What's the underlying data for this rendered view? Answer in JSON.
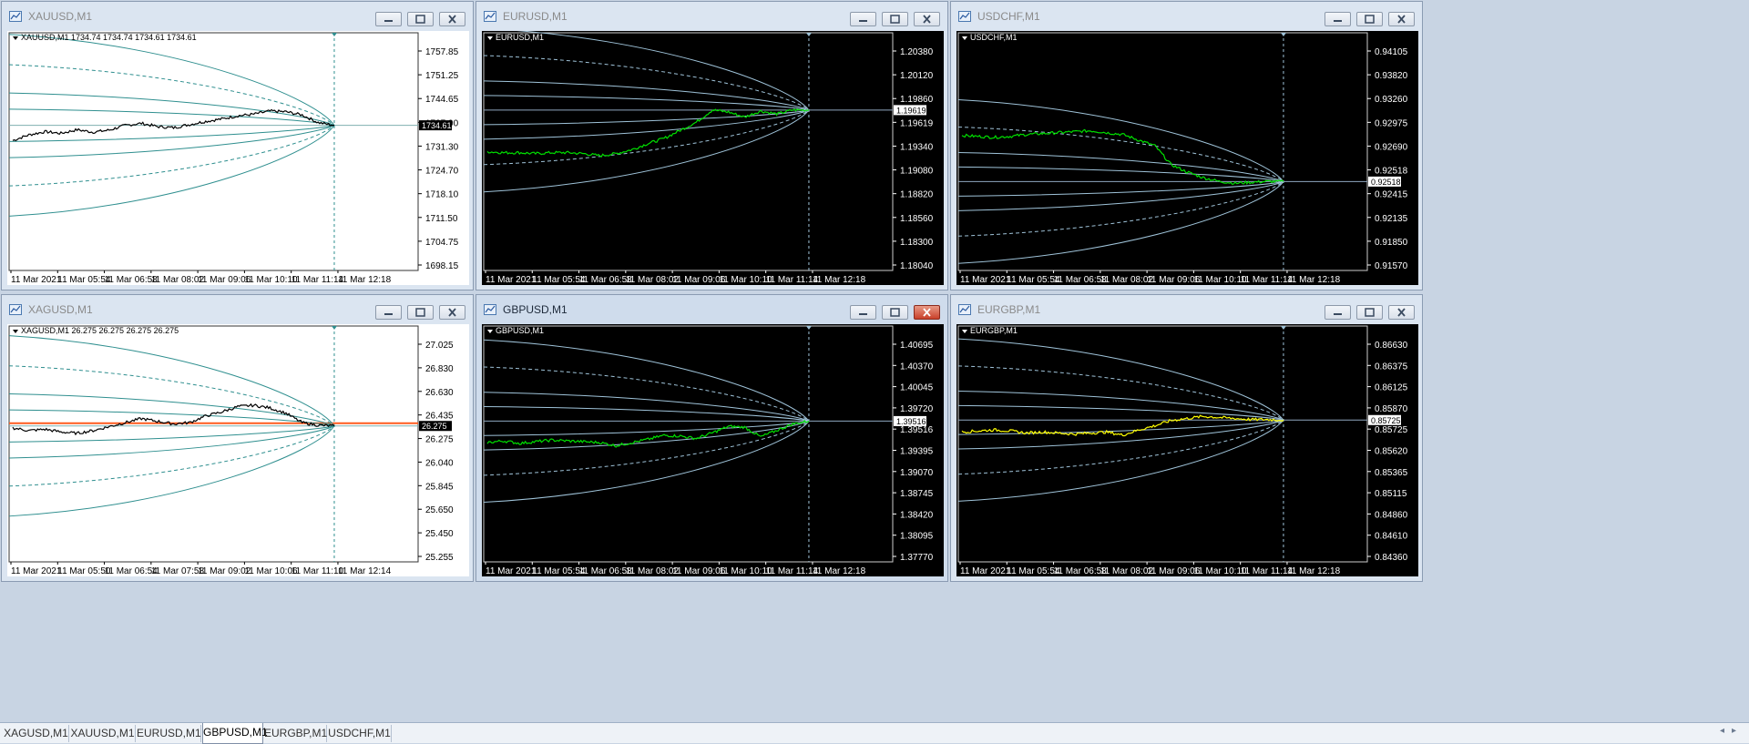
{
  "windows": [
    {
      "id": "xauusd",
      "title": "XAUUSD,M1",
      "theme": "light",
      "active": false,
      "close_red": false,
      "label": "XAUUSD,M1  1734.74 1734.74 1734.61 1734.61",
      "price_ticks": [
        "1757.85",
        "1751.25",
        "1744.65",
        "1737.90",
        "1731.30",
        "1724.70",
        "1718.10",
        "1711.50",
        "1704.75",
        "1698.15"
      ],
      "current_price": "1734.61",
      "price_marker_color": "#000000",
      "time_ticks": [
        "11 Mar 2021",
        "11 Mar 05:54",
        "11 Mar 06:58",
        "11 Mar 08:02",
        "11 Mar 09:06",
        "11 Mar 10:10",
        "11 Mar 11:14",
        "11 Mar 12:18"
      ],
      "series_color": "#000000",
      "band_color": "#2f8f8f",
      "chart_data": {
        "type": "line",
        "ylim": [
          1698.15,
          1757.85
        ],
        "x": [
          0,
          0.05,
          0.1,
          0.15,
          0.2,
          0.25,
          0.3,
          0.35,
          0.4,
          0.45,
          0.5,
          0.55,
          0.6,
          0.65,
          0.7,
          0.75,
          0.8,
          0.85,
          0.9,
          0.95,
          1.0
        ],
        "values": [
          1730.8,
          1732.2,
          1733.0,
          1732.6,
          1733.5,
          1732.9,
          1733.4,
          1734.6,
          1735.1,
          1734.3,
          1734.0,
          1734.8,
          1735.6,
          1736.2,
          1737.0,
          1737.4,
          1738.2,
          1738.0,
          1737.2,
          1735.3,
          1734.61
        ]
      }
    },
    {
      "id": "eurusd",
      "title": "EURUSD,M1",
      "theme": "dark",
      "active": false,
      "close_red": false,
      "label": "EURUSD,M1",
      "price_ticks": [
        "1.20380",
        "1.20120",
        "1.19860",
        "1.19619",
        "1.19340",
        "1.19080",
        "1.18820",
        "1.18560",
        "1.18300",
        "1.18040"
      ],
      "current_price": "1.19619",
      "price_marker_color": "#ffffff",
      "time_ticks": [
        "11 Mar 2021",
        "11 Mar 05:54",
        "11 Mar 06:58",
        "11 Mar 08:02",
        "11 Mar 09:06",
        "11 Mar 10:10",
        "11 Mar 11:14",
        "11 Mar 12:18"
      ],
      "series_color": "#00e000",
      "band_color": "#9fc3d9",
      "chart_data": {
        "type": "line",
        "ylim": [
          1.1804,
          1.2038
        ],
        "x": [
          0,
          0.05,
          0.1,
          0.15,
          0.2,
          0.25,
          0.3,
          0.35,
          0.4,
          0.45,
          0.5,
          0.55,
          0.6,
          0.65,
          0.7,
          0.75,
          0.8,
          0.85,
          0.9,
          0.95,
          1.0
        ],
        "values": [
          1.1921,
          1.192,
          1.192,
          1.1919,
          1.192,
          1.192,
          1.1919,
          1.1917,
          1.1919,
          1.1923,
          1.1929,
          1.1934,
          1.1942,
          1.195,
          1.1962,
          1.196,
          1.1955,
          1.1961,
          1.1958,
          1.1962,
          1.19619
        ]
      }
    },
    {
      "id": "usdchf",
      "title": "USDCHF,M1",
      "theme": "dark",
      "active": false,
      "close_red": false,
      "label": "USDCHF,M1",
      "price_ticks": [
        "0.94105",
        "0.93820",
        "0.93260",
        "0.92975",
        "0.92690",
        "0.92518",
        "0.92415",
        "0.92135",
        "0.91850",
        "0.91570"
      ],
      "current_price": "0.92518",
      "price_marker_color": "#ffffff",
      "time_ticks": [
        "11 Mar 2021",
        "11 Mar 05:54",
        "11 Mar 06:58",
        "11 Mar 08:02",
        "11 Mar 09:06",
        "11 Mar 10:10",
        "11 Mar 11:14",
        "11 Mar 12:18"
      ],
      "series_color": "#00e000",
      "band_color": "#9fc3d9",
      "chart_data": {
        "type": "line",
        "ylim": [
          0.9157,
          0.94105
        ],
        "x": [
          0,
          0.05,
          0.1,
          0.15,
          0.2,
          0.25,
          0.3,
          0.35,
          0.4,
          0.45,
          0.5,
          0.55,
          0.6,
          0.65,
          0.7,
          0.75,
          0.8,
          0.85,
          0.9,
          0.95,
          1.0
        ],
        "values": [
          0.9301,
          0.93,
          0.9299,
          0.93,
          0.9302,
          0.9303,
          0.9304,
          0.9305,
          0.9306,
          0.9304,
          0.9302,
          0.9296,
          0.929,
          0.927,
          0.9262,
          0.9256,
          0.9252,
          0.925,
          0.9251,
          0.9252,
          0.92518
        ]
      }
    },
    {
      "id": "xagusd",
      "title": "XAGUSD,M1",
      "theme": "light",
      "active": false,
      "close_red": false,
      "label": "XAGUSD,M1  26.275 26.275 26.275 26.275",
      "price_ticks": [
        "27.025",
        "26.830",
        "26.630",
        "26.435",
        "26.275",
        "26.040",
        "25.845",
        "25.650",
        "25.450",
        "25.255"
      ],
      "current_price": "26.275",
      "price_marker_color": "#000000",
      "time_ticks": [
        "11 Mar 2021",
        "11 Mar 05:50",
        "11 Mar 06:54",
        "11 Mar 07:58",
        "11 Mar 09:02",
        "11 Mar 10:06",
        "11 Mar 11:10",
        "11 Mar 12:14"
      ],
      "series_color": "#000000",
      "band_color": "#2f8f8f",
      "chart_data": {
        "type": "line",
        "ylim": [
          25.255,
          27.025
        ],
        "x": [
          0,
          0.05,
          0.1,
          0.15,
          0.2,
          0.25,
          0.3,
          0.35,
          0.4,
          0.45,
          0.5,
          0.55,
          0.6,
          0.65,
          0.7,
          0.75,
          0.8,
          0.85,
          0.9,
          0.95,
          1.0
        ],
        "values": [
          26.26,
          26.24,
          26.25,
          26.23,
          26.22,
          26.24,
          26.27,
          26.3,
          26.33,
          26.31,
          26.29,
          26.3,
          26.35,
          26.38,
          26.42,
          26.43,
          26.41,
          26.37,
          26.3,
          26.28,
          26.275
        ]
      }
    },
    {
      "id": "gbpusd",
      "title": "GBPUSD,M1",
      "theme": "dark",
      "active": true,
      "close_red": true,
      "label": "GBPUSD,M1",
      "price_ticks": [
        "1.40695",
        "1.40370",
        "1.40045",
        "1.39720",
        "1.39516",
        "1.39395",
        "1.39070",
        "1.38745",
        "1.38420",
        "1.38095",
        "1.37770"
      ],
      "current_price": "1.39516",
      "price_marker_color": "#ffffff",
      "time_ticks": [
        "11 Mar 2021",
        "11 Mar 05:54",
        "11 Mar 06:58",
        "11 Mar 08:02",
        "11 Mar 09:06",
        "11 Mar 10:10",
        "11 Mar 11:14",
        "11 Mar 12:18"
      ],
      "series_color": "#00e000",
      "band_color": "#9fc3d9",
      "chart_data": {
        "type": "line",
        "ylim": [
          1.3777,
          1.40695
        ],
        "x": [
          0,
          0.05,
          0.1,
          0.15,
          0.2,
          0.25,
          0.3,
          0.35,
          0.4,
          0.45,
          0.5,
          0.55,
          0.6,
          0.65,
          0.7,
          0.75,
          0.8,
          0.85,
          0.9,
          0.95,
          1.0
        ],
        "values": [
          1.3925,
          1.3927,
          1.3924,
          1.3926,
          1.3928,
          1.3927,
          1.3926,
          1.3925,
          1.3921,
          1.3925,
          1.3929,
          1.3934,
          1.3933,
          1.393,
          1.3937,
          1.3945,
          1.3944,
          1.3932,
          1.394,
          1.3948,
          1.39516
        ]
      }
    },
    {
      "id": "eurgbp",
      "title": "EURGBP,M1",
      "theme": "dark",
      "active": false,
      "close_red": false,
      "label": "EURGBP,M1",
      "price_ticks": [
        "0.86630",
        "0.86375",
        "0.86125",
        "0.85870",
        "0.85725",
        "0.85620",
        "0.85365",
        "0.85115",
        "0.84860",
        "0.84610",
        "0.84360"
      ],
      "current_price": "0.85725",
      "price_marker_color": "#ffffff",
      "time_ticks": [
        "11 Mar 2021",
        "11 Mar 05:54",
        "11 Mar 06:58",
        "11 Mar 08:02",
        "11 Mar 09:06",
        "11 Mar 10:10",
        "11 Mar 11:14",
        "11 Mar 12:18"
      ],
      "series_color": "#ffff00",
      "band_color": "#9fc3d9",
      "chart_data": {
        "type": "line",
        "ylim": [
          0.8436,
          0.8663
        ],
        "x": [
          0,
          0.05,
          0.1,
          0.15,
          0.2,
          0.25,
          0.3,
          0.35,
          0.4,
          0.45,
          0.5,
          0.55,
          0.6,
          0.65,
          0.7,
          0.75,
          0.8,
          0.85,
          0.9,
          0.95,
          1.0
        ],
        "values": [
          0.8561,
          0.8562,
          0.8563,
          0.8562,
          0.856,
          0.8561,
          0.856,
          0.8559,
          0.856,
          0.8561,
          0.8558,
          0.8563,
          0.8567,
          0.8572,
          0.8574,
          0.8576,
          0.8575,
          0.8574,
          0.8573,
          0.8573,
          0.85725
        ]
      }
    }
  ],
  "tabs": [
    {
      "label": "XAGUSD,M1",
      "active": false
    },
    {
      "label": "XAUUSD,M1",
      "active": false
    },
    {
      "label": "EURUSD,M1",
      "active": false
    },
    {
      "label": "GBPUSD,M1",
      "active": true
    },
    {
      "label": "EURGBP,M1",
      "active": false
    },
    {
      "label": "USDCHF,M1",
      "active": false
    }
  ],
  "colors": {
    "light_bg": "#ffffff",
    "dark_bg": "#000000",
    "frame": "#dbe5f1"
  }
}
